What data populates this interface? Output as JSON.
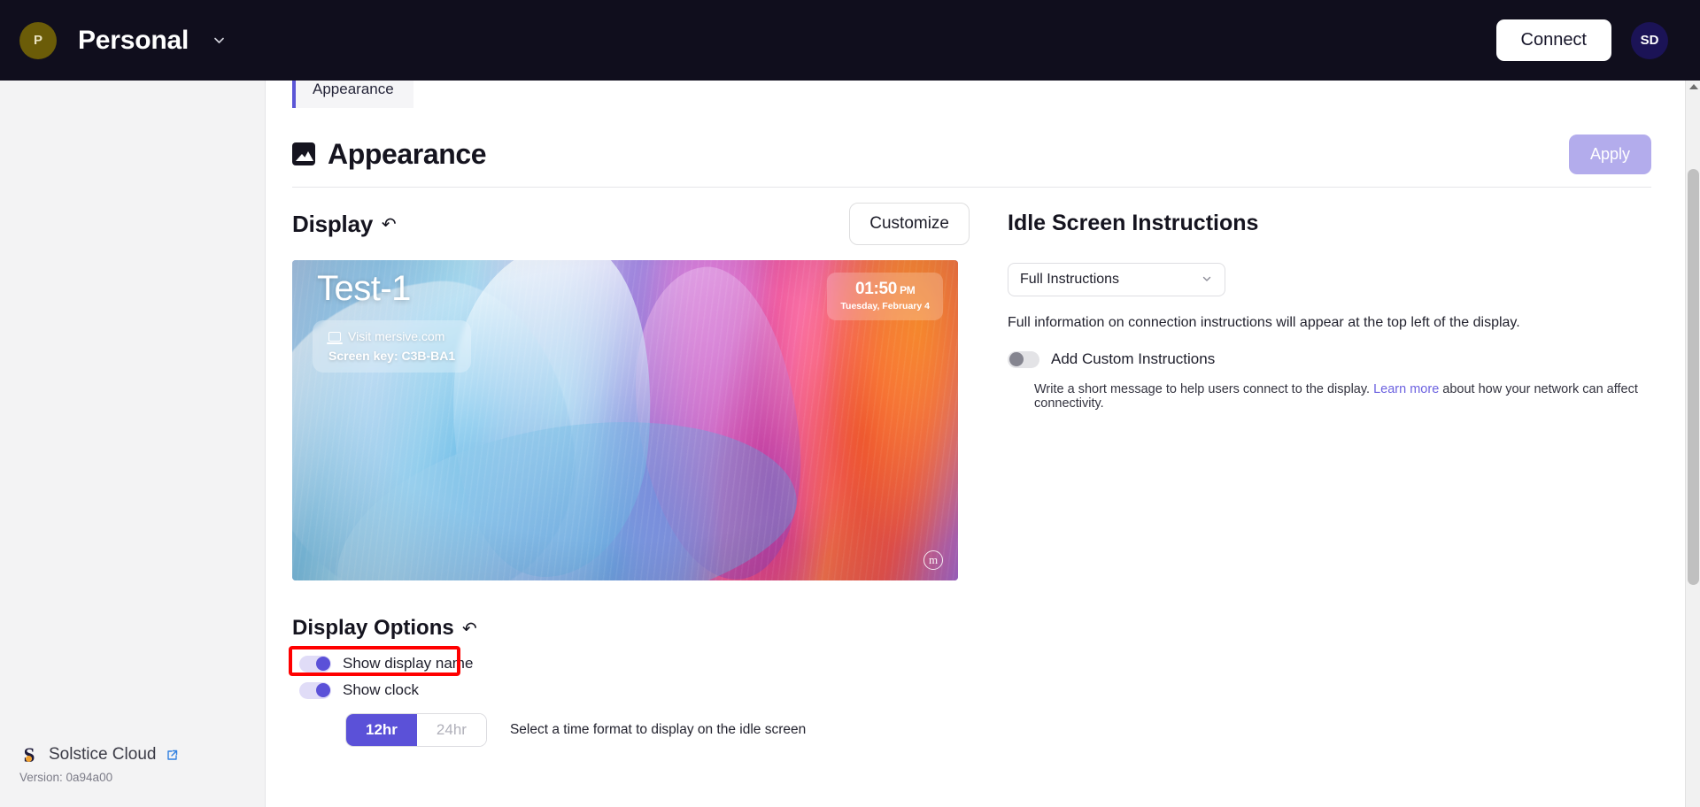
{
  "topbar": {
    "org_initial": "P",
    "org_name": "Personal",
    "caret_icon": "chevron-down-icon",
    "connect_label": "Connect",
    "user_initials": "SD"
  },
  "sidebar": {
    "footer": {
      "product_name": "Solstice Cloud",
      "external_link_icon": "external-link-icon",
      "version": "Version: 0a94a00"
    }
  },
  "main": {
    "tab_label": "Appearance",
    "page_title": "Appearance",
    "page_title_icon": "image-icon",
    "apply_label": "Apply"
  },
  "display": {
    "section_title": "Display",
    "reset_icon": "undo-reset-icon",
    "customize_label": "Customize",
    "preview": {
      "display_name": "Test-1",
      "laptop_icon": "laptop-icon",
      "visit_text": "Visit mersive.com",
      "screen_key": "Screen key: C3B-BA1",
      "clock_time": "01:50",
      "clock_ampm": "PM",
      "clock_date": "Tuesday, February 4",
      "watermark": "m"
    }
  },
  "display_options": {
    "section_title": "Display Options",
    "reset_icon": "undo-reset-icon",
    "show_display_name": {
      "label": "Show display name",
      "state": "on",
      "highlighted": true
    },
    "show_clock": {
      "label": "Show clock",
      "state": "on"
    },
    "time_format": {
      "options": [
        "12hr",
        "24hr"
      ],
      "selected": "12hr",
      "hint": "Select a time format to display on the idle screen"
    }
  },
  "idle_screen": {
    "title": "Idle Screen Instructions",
    "select_value": "Full Instructions",
    "select_caret_icon": "chevron-down-icon",
    "description": "Full information on connection instructions will appear at the top left of the display.",
    "custom_toggle": {
      "label": "Add Custom Instructions",
      "state": "off"
    },
    "hint_before": "Write a short message to help users connect to the display. ",
    "hint_link": "Learn more",
    "hint_after": " about how your network can affect connectivity."
  },
  "colors": {
    "accent": "#5b51d8",
    "topbar_bg": "#100e1d",
    "annotation": "#ff0000",
    "link": "#6c62e0"
  }
}
